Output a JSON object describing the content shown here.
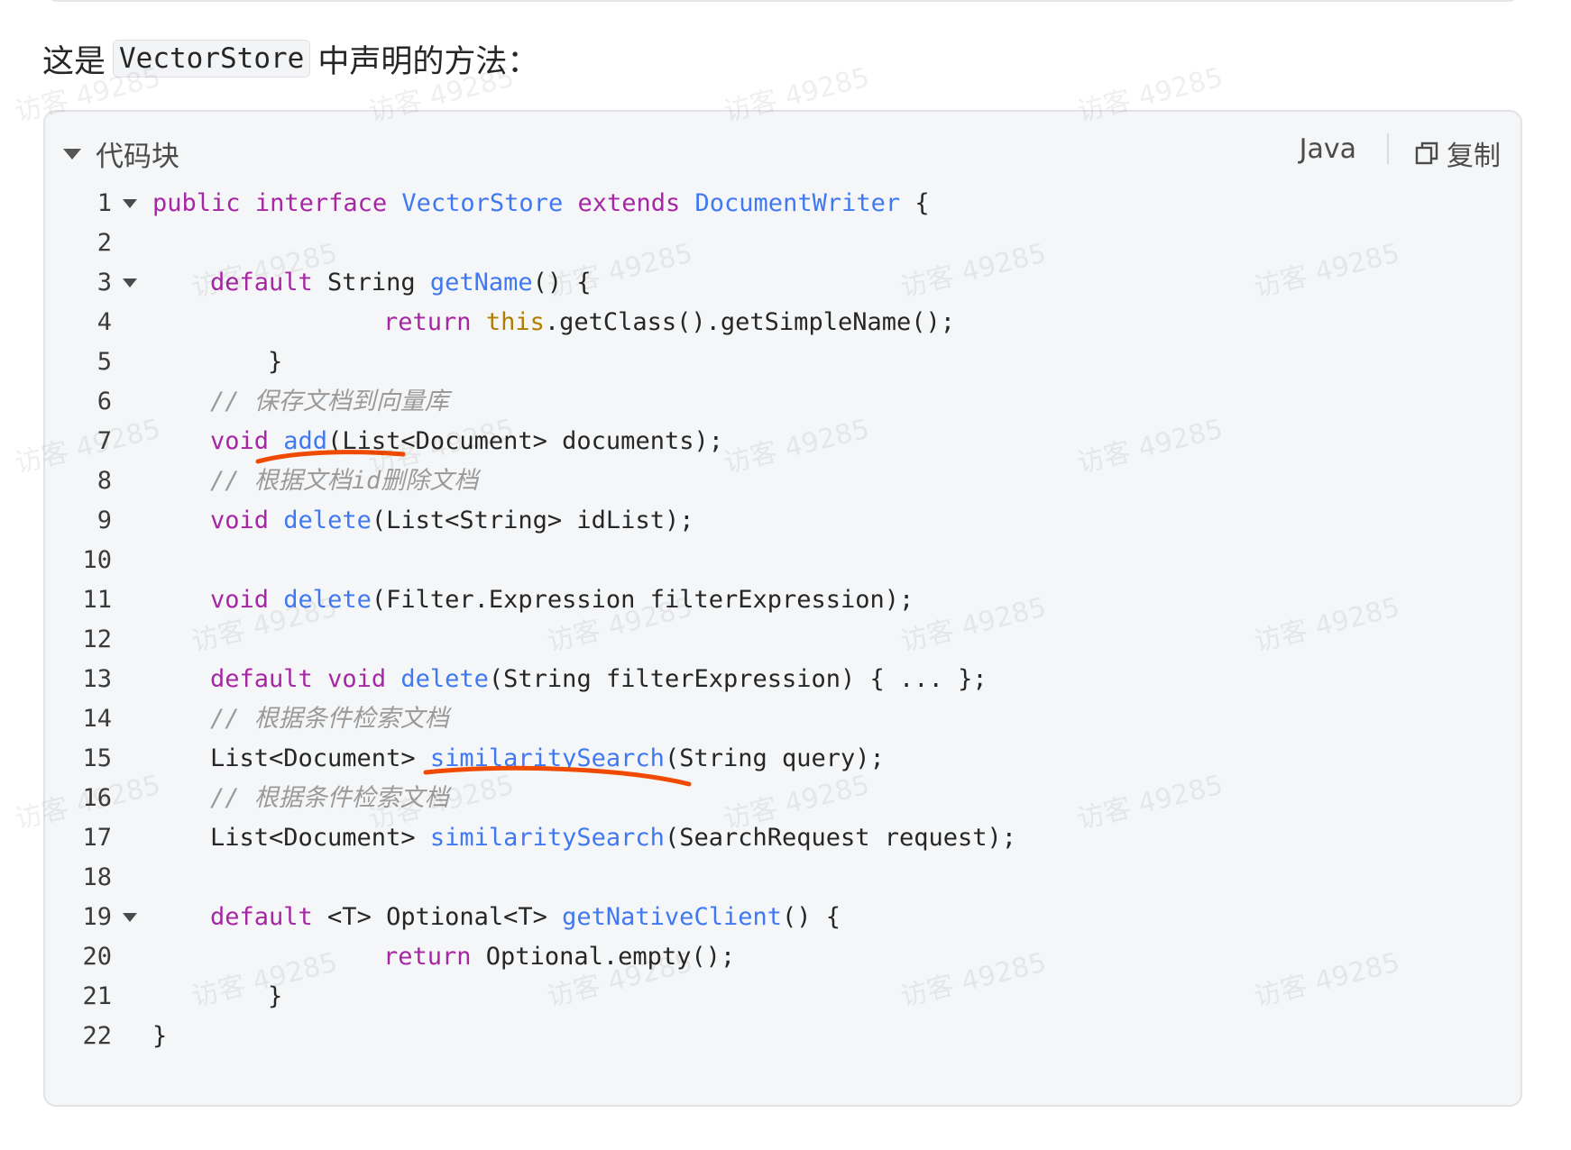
{
  "intro": {
    "before": "这是",
    "code": "VectorStore",
    "after": "中声明的方法："
  },
  "code_block": {
    "collapse_label": "代码块",
    "language": "Java",
    "copy_label": "复制",
    "lines": [
      {
        "n": "1",
        "fold": true,
        "indent": 0,
        "tokens": [
          [
            "kw",
            "public"
          ],
          [
            "pl",
            " "
          ],
          [
            "kw",
            "interface"
          ],
          [
            "pl",
            " "
          ],
          [
            "fn",
            "VectorStore"
          ],
          [
            "pl",
            " "
          ],
          [
            "kw",
            "extends"
          ],
          [
            "pl",
            " "
          ],
          [
            "fn",
            "DocumentWriter"
          ],
          [
            "pl",
            " {"
          ]
        ]
      },
      {
        "n": "2",
        "fold": false,
        "indent": 0,
        "tokens": []
      },
      {
        "n": "3",
        "fold": true,
        "indent": 4,
        "tokens": [
          [
            "kw",
            "default"
          ],
          [
            "pl",
            " String "
          ],
          [
            "fn",
            "getName"
          ],
          [
            "pl",
            "() {"
          ]
        ]
      },
      {
        "n": "4",
        "fold": false,
        "indent": 16,
        "tokens": [
          [
            "kw",
            "return"
          ],
          [
            "pl",
            " "
          ],
          [
            "th",
            "this"
          ],
          [
            "pl",
            ".getClass().getSimpleName();"
          ]
        ]
      },
      {
        "n": "5",
        "fold": false,
        "indent": 8,
        "tokens": [
          [
            "pl",
            "}"
          ]
        ]
      },
      {
        "n": "6",
        "fold": false,
        "indent": 4,
        "tokens": [
          [
            "cm",
            "// 保存文档到向量库"
          ]
        ]
      },
      {
        "n": "7",
        "fold": false,
        "indent": 4,
        "tokens": [
          [
            "kw",
            "void"
          ],
          [
            "pl",
            " "
          ],
          [
            "fn",
            "add"
          ],
          [
            "pl",
            "(List<Document> documents);"
          ]
        ]
      },
      {
        "n": "8",
        "fold": false,
        "indent": 4,
        "tokens": [
          [
            "cm",
            "// 根据文档id删除文档"
          ]
        ]
      },
      {
        "n": "9",
        "fold": false,
        "indent": 4,
        "tokens": [
          [
            "kw",
            "void"
          ],
          [
            "pl",
            " "
          ],
          [
            "fn",
            "delete"
          ],
          [
            "pl",
            "(List<String> idList);"
          ]
        ]
      },
      {
        "n": "10",
        "fold": false,
        "indent": 0,
        "tokens": []
      },
      {
        "n": "11",
        "fold": false,
        "indent": 4,
        "tokens": [
          [
            "kw",
            "void"
          ],
          [
            "pl",
            " "
          ],
          [
            "fn",
            "delete"
          ],
          [
            "pl",
            "(Filter.Expression filterExpression);"
          ]
        ]
      },
      {
        "n": "12",
        "fold": false,
        "indent": 0,
        "tokens": []
      },
      {
        "n": "13",
        "fold": false,
        "indent": 4,
        "tokens": [
          [
            "kw",
            "default"
          ],
          [
            "pl",
            " "
          ],
          [
            "kw",
            "void"
          ],
          [
            "pl",
            " "
          ],
          [
            "fn",
            "delete"
          ],
          [
            "pl",
            "(String filterExpression) { ... };"
          ]
        ]
      },
      {
        "n": "14",
        "fold": false,
        "indent": 4,
        "tokens": [
          [
            "cm",
            "// 根据条件检索文档"
          ]
        ]
      },
      {
        "n": "15",
        "fold": false,
        "indent": 4,
        "tokens": [
          [
            "pl",
            "List<Document> "
          ],
          [
            "fn",
            "similaritySearch"
          ],
          [
            "pl",
            "(String query);"
          ]
        ]
      },
      {
        "n": "16",
        "fold": false,
        "indent": 4,
        "tokens": [
          [
            "cm",
            "// 根据条件检索文档"
          ]
        ]
      },
      {
        "n": "17",
        "fold": false,
        "indent": 4,
        "tokens": [
          [
            "pl",
            "List<Document> "
          ],
          [
            "fn",
            "similaritySearch"
          ],
          [
            "pl",
            "(SearchRequest request);"
          ]
        ]
      },
      {
        "n": "18",
        "fold": false,
        "indent": 0,
        "tokens": []
      },
      {
        "n": "19",
        "fold": true,
        "indent": 4,
        "tokens": [
          [
            "kw",
            "default"
          ],
          [
            "pl",
            " <T> Optional<T> "
          ],
          [
            "fn",
            "getNativeClient"
          ],
          [
            "pl",
            "() {"
          ]
        ]
      },
      {
        "n": "20",
        "fold": false,
        "indent": 16,
        "tokens": [
          [
            "kw",
            "return"
          ],
          [
            "pl",
            " Optional.empty();"
          ]
        ]
      },
      {
        "n": "21",
        "fold": false,
        "indent": 8,
        "tokens": [
          [
            "pl",
            "}"
          ]
        ]
      },
      {
        "n": "22",
        "fold": false,
        "indent": 0,
        "tokens": [
          [
            "pl",
            "}"
          ]
        ]
      }
    ]
  },
  "watermark": "访客 49285",
  "colors": {
    "keyword": "#a626a4",
    "function": "#4078f2",
    "this": "#b07d00",
    "comment": "#9a9a9a",
    "annotation": "#f04a00"
  }
}
